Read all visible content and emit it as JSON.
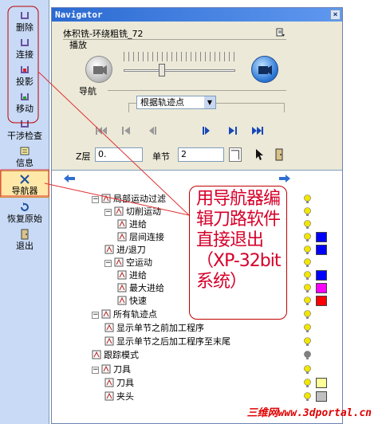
{
  "toolbar": {
    "items": [
      {
        "label": "删除",
        "icon": "delete-icon"
      },
      {
        "label": "连接",
        "icon": "link-icon"
      },
      {
        "label": "投影",
        "icon": "projection-icon"
      },
      {
        "label": "移动",
        "icon": "move-icon"
      },
      {
        "label": "干涉检查",
        "icon": "collision-check-icon"
      },
      {
        "label": "信息",
        "icon": "info-icon"
      },
      {
        "label": "导航器",
        "icon": "navigator-icon",
        "active": true
      },
      {
        "label": "恢复原始",
        "icon": "restore-icon"
      },
      {
        "label": "退出",
        "icon": "exit-icon"
      }
    ]
  },
  "window": {
    "title": "Navigator",
    "close": "×",
    "operation": "体积铣-环绕粗铣_72",
    "play_label": "播放",
    "nav_label": "导航",
    "mode": "根据轨迹点",
    "z_label": "Z层",
    "z_value": "0.",
    "step_label": "单节",
    "step_value": "2"
  },
  "tree": {
    "rows": [
      {
        "label": "局部运动过滤",
        "exp": "−",
        "icon": "motion-filter-icon"
      },
      {
        "label": "切削运动",
        "exp": "−",
        "icon": "cut-motion-icon"
      },
      {
        "label": "进给",
        "icon": "feed-icon"
      },
      {
        "label": "层间连接",
        "icon": "layer-link-icon"
      },
      {
        "label": "进/退刀",
        "icon": "approach-retract-icon"
      },
      {
        "label": "空运动",
        "exp": "−",
        "icon": "air-motion-icon"
      },
      {
        "label": "进给",
        "icon": "feed-icon"
      },
      {
        "label": "最大进给",
        "icon": "max-feed-icon"
      },
      {
        "label": "快速",
        "icon": "rapid-icon"
      },
      {
        "label": "所有轨迹点",
        "exp": "−",
        "icon": "toolpath-points-icon"
      },
      {
        "label": "显示单节之前加工程序",
        "icon": "show-before-icon"
      },
      {
        "label": "显示单节之后加工程序至末尾",
        "icon": "show-after-icon"
      },
      {
        "label": "跟踪模式",
        "icon": "trace-mode-icon"
      },
      {
        "label": "刀具",
        "exp": "−",
        "icon": "tool-icon"
      },
      {
        "label": "刀具",
        "icon": "tool-icon"
      },
      {
        "label": "夹头",
        "icon": "holder-icon"
      }
    ],
    "bulbs": [
      {
        "color": "#f2e600"
      },
      {
        "color": "#f2e600"
      },
      {
        "color": "#f2e600"
      },
      {
        "color": "#f2e600"
      },
      {
        "color": "#f2e600"
      },
      {
        "color": "#f2e600"
      },
      {
        "color": "#f2e600"
      },
      {
        "color": "#f2e600"
      },
      {
        "color": "#f2e600"
      },
      {
        "color": "#f2e600"
      },
      {
        "color": "#f2e600"
      },
      {
        "color": "#f2e600"
      },
      {
        "color": "#808080"
      },
      {
        "color": "#f2e600"
      },
      {
        "color": "#f2e600"
      },
      {
        "color": "#f2e600"
      }
    ],
    "swatches": [
      "#0000ff",
      "#0000ff",
      "#0000ff",
      "#ff00ff",
      "#ff0000",
      "#ffff99",
      "#c0c0c0"
    ]
  },
  "annotation": {
    "text": "用导航器编辑刀路软件直接退出（XP-32bit系统）",
    "color": "#d6002a"
  },
  "watermark": "三维网www.3dportal.cn"
}
